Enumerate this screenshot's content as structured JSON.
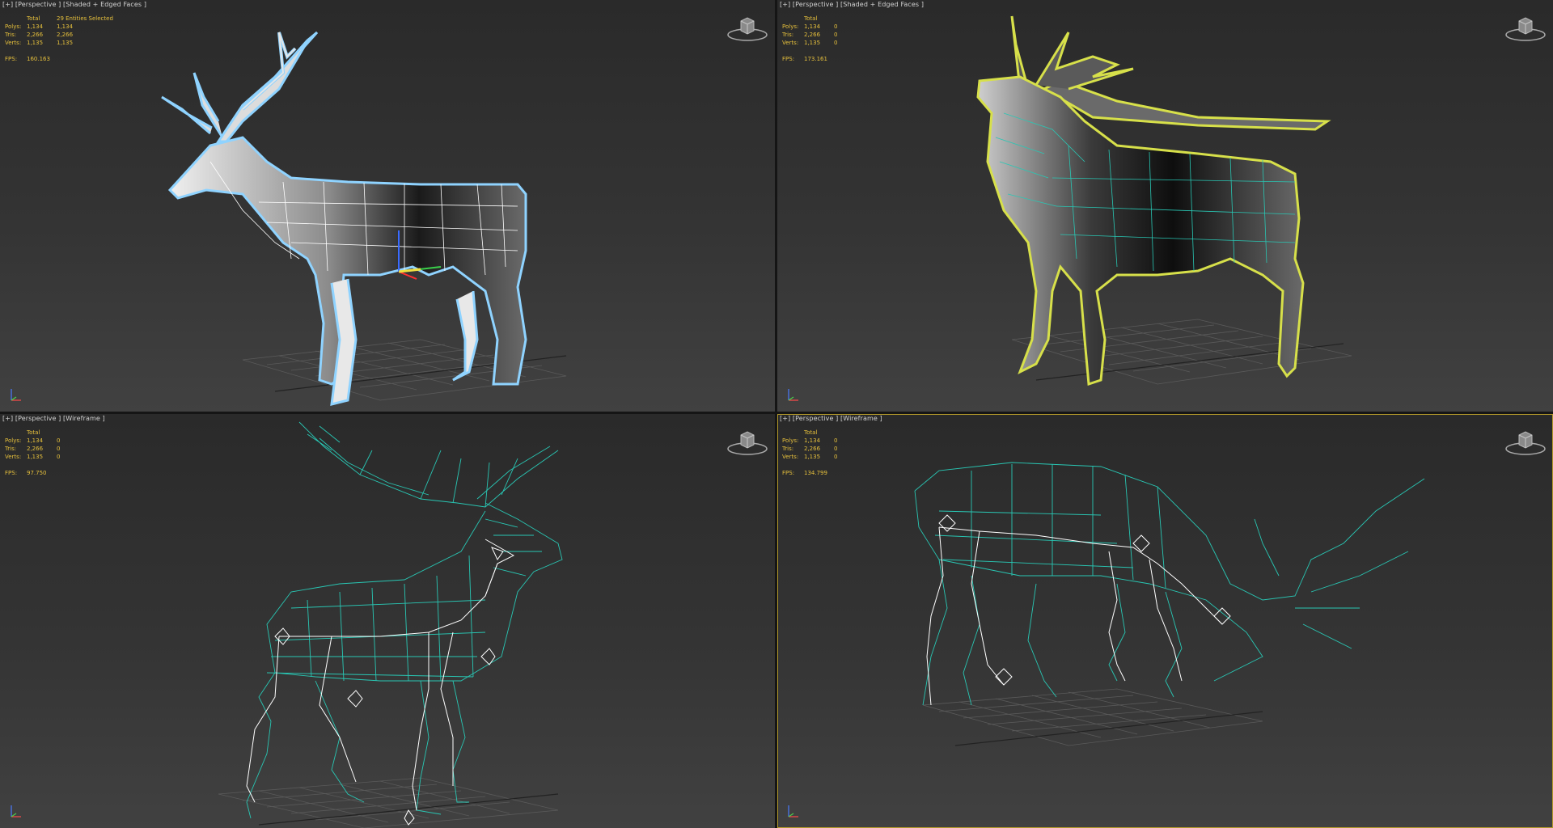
{
  "viewports": [
    {
      "label": "[+] [Perspective ] [Shaded + Edged Faces ]",
      "header": {
        "c1": "Total",
        "c2": "29 Entities Selected"
      },
      "rows": [
        {
          "name": "Polys:",
          "total": "1,134",
          "sel": "1,134"
        },
        {
          "name": "Tris:",
          "total": "2,266",
          "sel": "2,266"
        },
        {
          "name": "Verts:",
          "total": "1,135",
          "sel": "1,135"
        }
      ],
      "fps_label": "FPS:",
      "fps": "160.163"
    },
    {
      "label": "[+] [Perspective ] [Shaded + Edged Faces ]",
      "header": {
        "c1": "Total",
        "c2": ""
      },
      "rows": [
        {
          "name": "Polys:",
          "total": "1,134",
          "sel": "0"
        },
        {
          "name": "Tris:",
          "total": "2,266",
          "sel": "0"
        },
        {
          "name": "Verts:",
          "total": "1,135",
          "sel": "0"
        }
      ],
      "fps_label": "FPS:",
      "fps": "173.161"
    },
    {
      "label": "[+] [Perspective ] [Wireframe ]",
      "header": {
        "c1": "Total",
        "c2": ""
      },
      "rows": [
        {
          "name": "Polys:",
          "total": "1,134",
          "sel": "0"
        },
        {
          "name": "Tris:",
          "total": "2,266",
          "sel": "0"
        },
        {
          "name": "Verts:",
          "total": "1,135",
          "sel": "0"
        }
      ],
      "fps_label": "FPS:",
      "fps": "97.750"
    },
    {
      "label": "[+] [Perspective ] [Wireframe ]",
      "header": {
        "c1": "Total",
        "c2": ""
      },
      "rows": [
        {
          "name": "Polys:",
          "total": "1,134",
          "sel": "0"
        },
        {
          "name": "Tris:",
          "total": "2,266",
          "sel": "0"
        },
        {
          "name": "Verts:",
          "total": "1,135",
          "sel": "0"
        }
      ],
      "fps_label": "FPS:",
      "fps": "134.799"
    }
  ],
  "colors": {
    "stats_text": "#e6c03c",
    "wire_cyan": "#29c7b4",
    "select_outline_blue": "#8fd3ff",
    "select_outline_yellow": "#d7e04a",
    "active_border": "#b49a2a"
  },
  "icons": [
    "viewcube-icon",
    "axis-tripod-icon"
  ]
}
